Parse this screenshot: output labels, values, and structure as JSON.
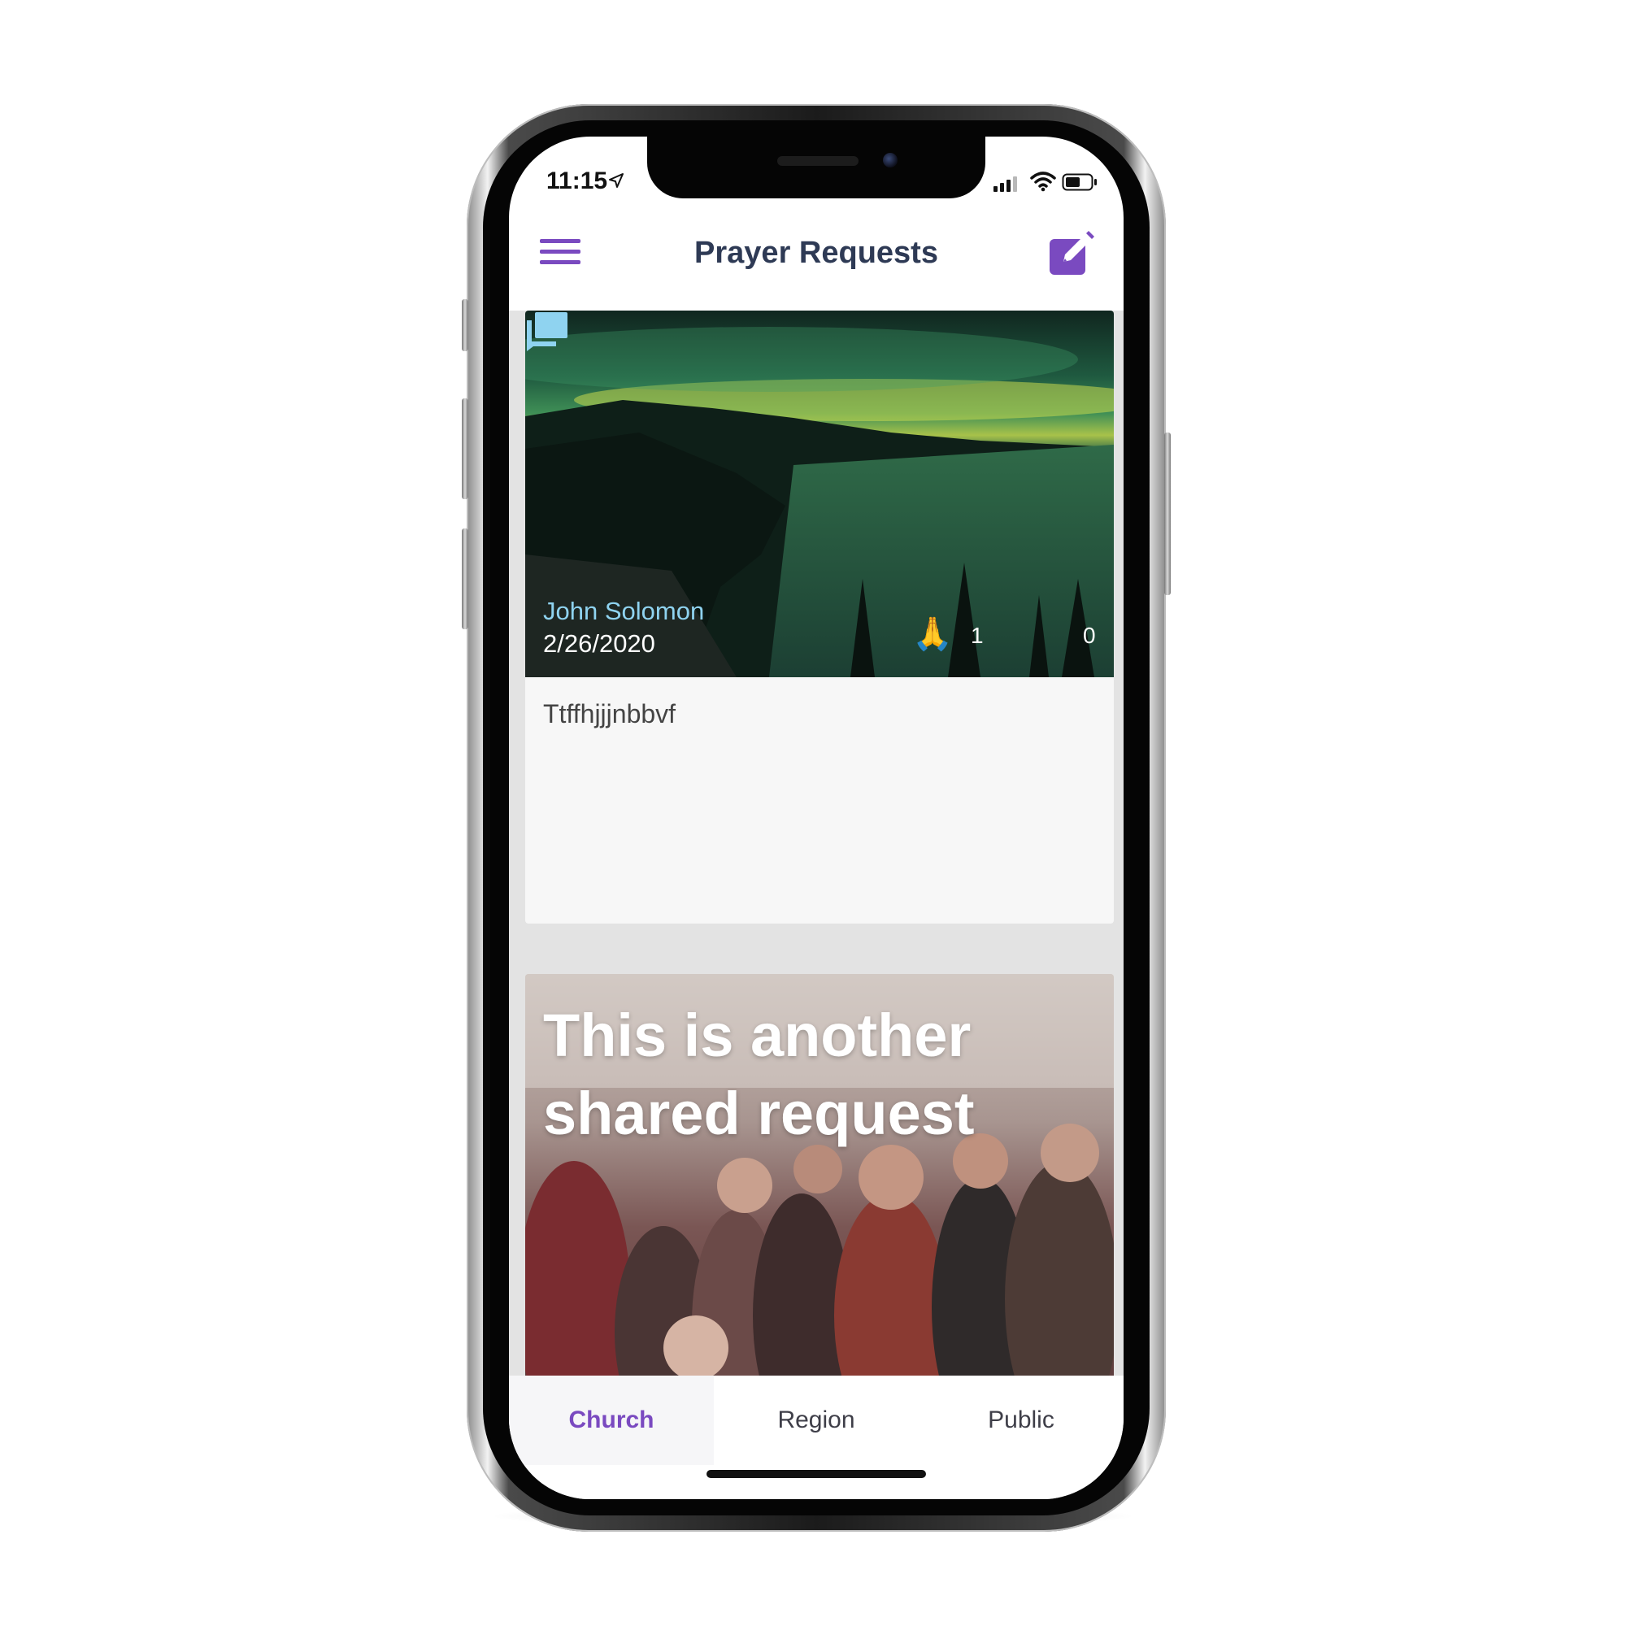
{
  "status_bar": {
    "time": "11:15",
    "icons": [
      "location-arrow-icon",
      "signal-icon",
      "wifi-icon",
      "battery-icon"
    ]
  },
  "header": {
    "title": "Prayer Requests",
    "left_icon": "menu-icon",
    "right_icon": "compose-icon"
  },
  "feed": {
    "cards": [
      {
        "author": "John Solomon",
        "date": "2/26/2020",
        "pray_count": "1",
        "comment_count": "0",
        "body": "Ttffhjjjnbbvf",
        "image": "aurora-lake-landscape"
      },
      {
        "overlay_text": "This is another shared request",
        "image": "congregation-worship-photo"
      }
    ]
  },
  "tabs": [
    {
      "label": "Church",
      "active": true
    },
    {
      "label": "Region",
      "active": false
    },
    {
      "label": "Public",
      "active": false
    }
  ],
  "colors": {
    "accent": "#7a4ac0",
    "title": "#2e3a55",
    "author": "#8fd3f0",
    "feed_background": "#e3e3e3"
  }
}
